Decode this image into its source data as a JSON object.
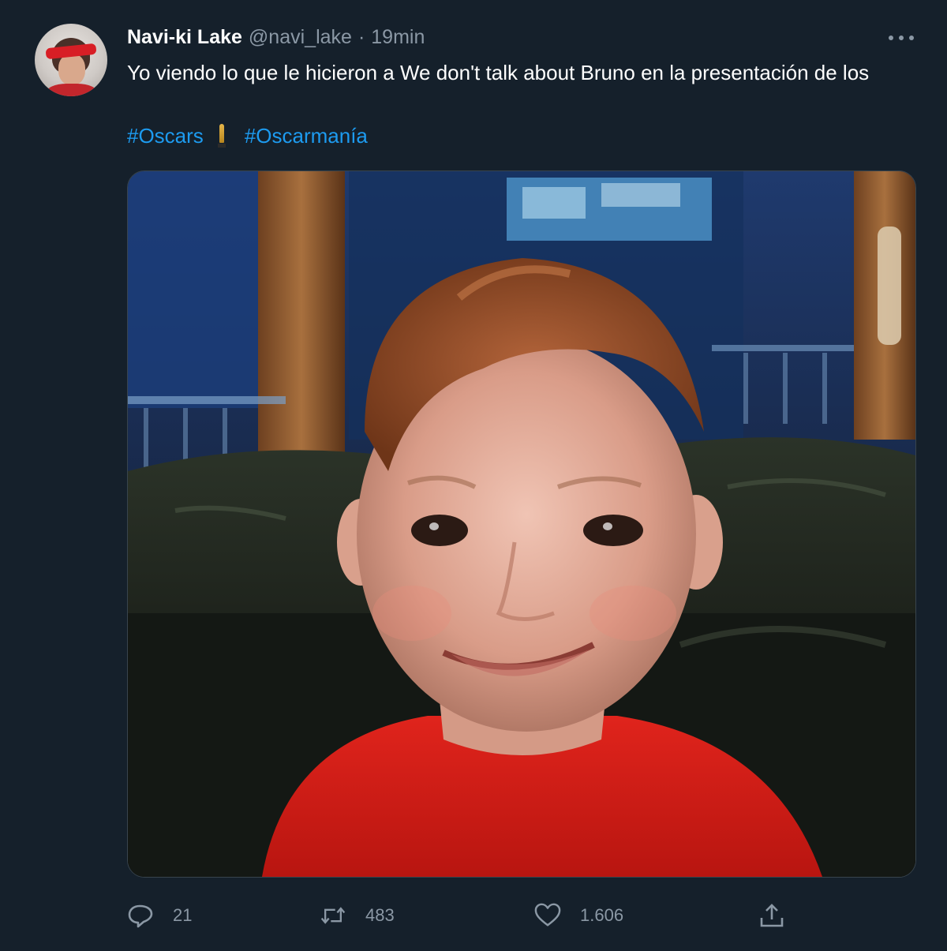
{
  "tweet": {
    "display_name": "Navi-ki Lake",
    "handle": "@navi_lake",
    "separator": "·",
    "time": "19min",
    "text": "Yo viendo lo que le hicieron a We don't talk about Bruno en la presentación de los",
    "hashtags": [
      "#Oscars",
      "#Oscarmanía"
    ],
    "more_icon": "more-icon"
  },
  "actions": {
    "reply_count": "21",
    "retweet_count": "483",
    "like_count": "1.606",
    "reply_icon": "reply-icon",
    "retweet_icon": "retweet-icon",
    "like_icon": "heart-icon",
    "share_icon": "share-icon"
  },
  "colors": {
    "background": "#15202b",
    "text_primary": "#ffffff",
    "text_secondary": "#8b98a5",
    "link": "#1d9bf0"
  }
}
